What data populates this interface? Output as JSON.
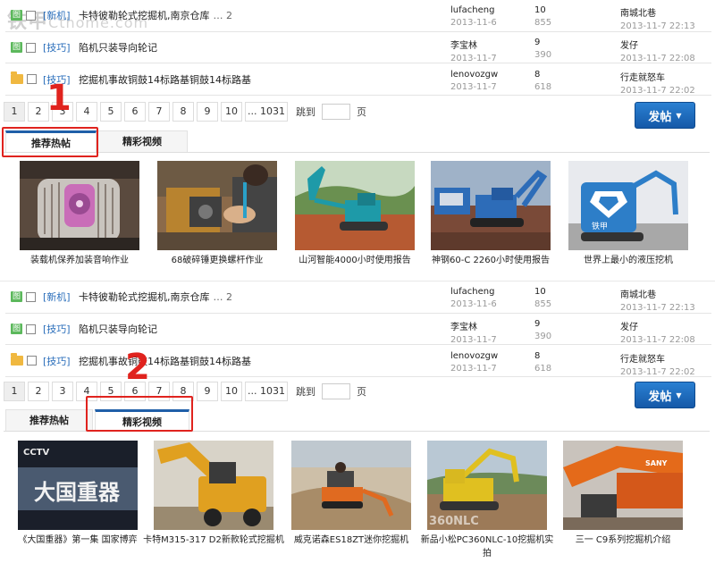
{
  "watermark": {
    "logo": "铁甲",
    "url": "Cthome.com"
  },
  "threads": [
    {
      "tag": "[新机]",
      "title": "卡特彼勒轮式挖掘机,南京仓库",
      "pages": "… 2",
      "author": "lufacheng",
      "date": "2013-11-6",
      "replies": "10",
      "views": "855",
      "last_user": "南城北巷",
      "last_time": "2013-11-7 22:13",
      "icon": "pic"
    },
    {
      "tag": "[技巧]",
      "title": "陷机只装导向轮记",
      "pages": "",
      "author": "李宝林",
      "date": "2013-11-7",
      "replies": "9",
      "views": "390",
      "last_user": "发仔",
      "last_time": "2013-11-7 22:08",
      "icon": "pic"
    },
    {
      "tag": "[技巧]",
      "title": "挖掘机事故铜鼓14标路基铜鼓14标路基",
      "pages": "",
      "author": "lenovozgw",
      "date": "2013-11-7",
      "replies": "8",
      "views": "618",
      "last_user": "行走就怒车",
      "last_time": "2013-11-7 22:02",
      "icon": "folder"
    }
  ],
  "pager": {
    "pages": [
      "1",
      "2",
      "3",
      "4",
      "5",
      "6",
      "7",
      "8",
      "9",
      "10",
      "... 1031"
    ],
    "jump_label": "跳到",
    "page_suffix": "页"
  },
  "post_button": "发帖",
  "tabs": [
    "推荐热帖",
    "精彩视频"
  ],
  "callouts": [
    "1",
    "2"
  ],
  "hot_posts": [
    {
      "caption": "装载机保养加装音响作业",
      "icon": "machine-cover-photo"
    },
    {
      "caption": "68破碎锤更换螺杆作业",
      "icon": "repair-photo"
    },
    {
      "caption": "山河智能4000小时使用报告",
      "icon": "excavator-photo"
    },
    {
      "caption": "神钢60-C 2260小时使用报告",
      "icon": "excavator-photo"
    },
    {
      "caption": "世界上最小的液压挖机",
      "icon": "mini-excavator-photo"
    }
  ],
  "videos": [
    {
      "caption": "《大国重器》第一集 国家博弈",
      "thumb_text": "大国重器",
      "channel": "CCTV",
      "icon": "tv-video-thumbnail"
    },
    {
      "caption": "卡特M315-317 D2新款轮式挖掘机",
      "icon": "excavator-video-thumbnail"
    },
    {
      "caption": "威克诺森ES18ZT迷你挖掘机",
      "icon": "mini-excavator-video-thumbnail"
    },
    {
      "caption": "新品小松PC360NLC-10挖掘机实拍",
      "icon": "excavator-video-thumbnail"
    },
    {
      "caption": "三一 C9系列挖掘机介绍",
      "icon": "excavator-video-thumbnail"
    }
  ],
  "colors": {
    "link": "#2a6ebb",
    "accent": "#1f5fa8",
    "callout": "#e0231e"
  }
}
